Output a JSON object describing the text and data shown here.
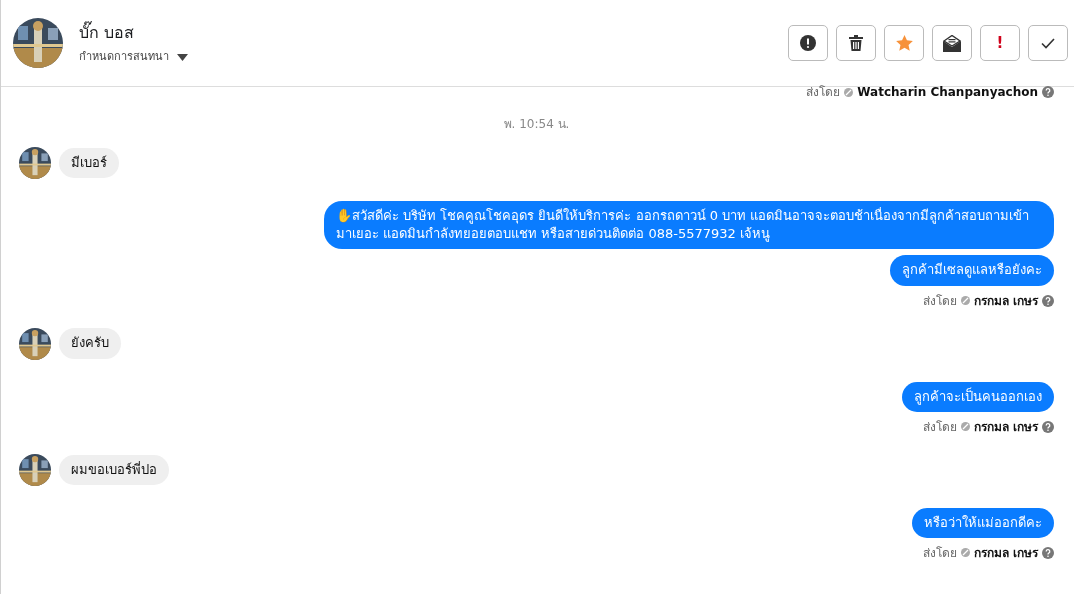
{
  "header": {
    "name": "บั๊ก บอส",
    "subtitle": "กำหนดการสนทนา",
    "actions": [
      {
        "kind": "alert"
      },
      {
        "kind": "trash"
      },
      {
        "kind": "star"
      },
      {
        "kind": "mail"
      },
      {
        "kind": "important",
        "text": "!"
      },
      {
        "kind": "check"
      }
    ]
  },
  "messages": [
    {
      "kind": "sender",
      "by_label": "ส่งโดย",
      "sender": "Watcharin Chanpanyachon"
    },
    {
      "kind": "time",
      "text": "พ. 10:54 น."
    },
    {
      "kind": "in",
      "text": "มีเบอร์"
    },
    {
      "kind": "out",
      "text": "✋สวัสดีค่ะ บริษัท โชคคูณโชคอุดร ยินดีให้บริการค่ะ ออกรถดาวน์ 0 บาท แอดมินอาจจะตอบช้าเนื่องจากมีลูกค้าสอบถามเข้ามาเยอะ แอดมินกำลังทยอยตอบแชท หรือสายด่วนติดต่อ 088-5577932 เจ้หนู"
    },
    {
      "kind": "out",
      "text": "ลูกค้ามีเซลดูแลหรือยังคะ"
    },
    {
      "kind": "sender",
      "by_label": "ส่งโดย",
      "sender": "กรกมล เกษร"
    },
    {
      "kind": "in",
      "text": "ยังครับ"
    },
    {
      "kind": "out",
      "text": "ลูกค้าจะเป็นคนออกเอง"
    },
    {
      "kind": "sender",
      "by_label": "ส่งโดย",
      "sender": "กรกมล เกษร"
    },
    {
      "kind": "in",
      "text": "ผมขอเบอร์พี่ปอ"
    },
    {
      "kind": "out",
      "text": "หรือว่าให้แม่ออกดีคะ"
    },
    {
      "kind": "sender",
      "by_label": "ส่งโดย",
      "sender": "กรกมล เกษร"
    }
  ]
}
